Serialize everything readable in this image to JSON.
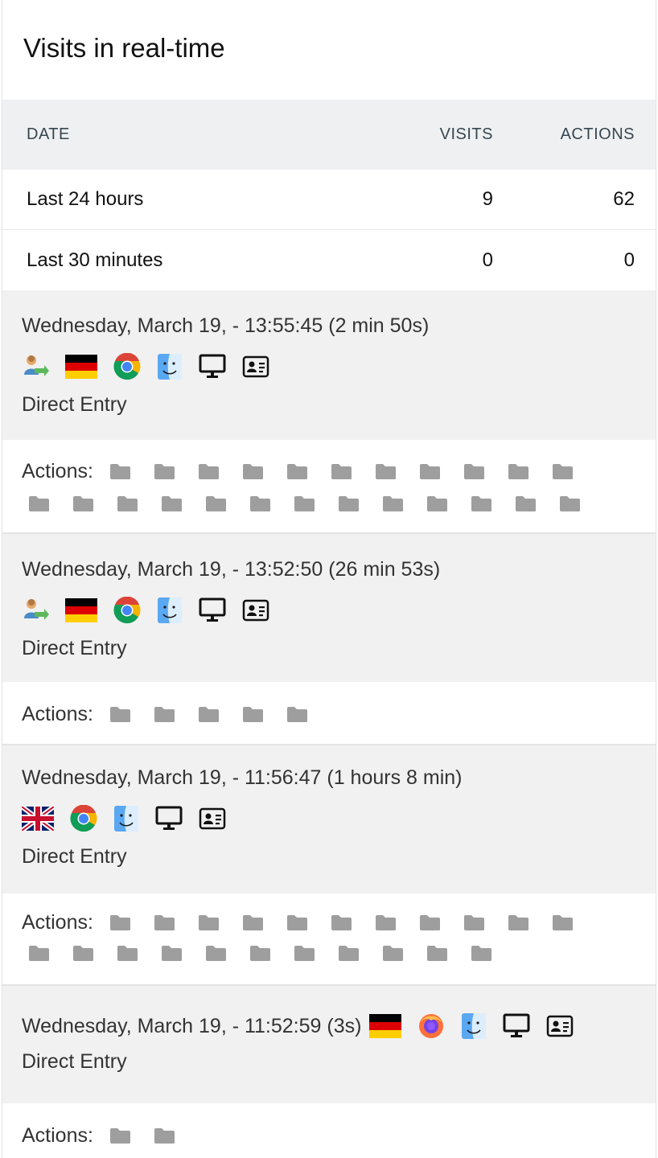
{
  "widget": {
    "title": "Visits in real-time"
  },
  "summary": {
    "headers": {
      "date": "DATE",
      "visits": "VISITS",
      "actions": "ACTIONS"
    },
    "rows": [
      {
        "label": "Last 24 hours",
        "visits": "9",
        "actions": "62"
      },
      {
        "label": "Last 30 minutes",
        "visits": "0",
        "actions": "0"
      }
    ]
  },
  "visits": [
    {
      "time": "Wednesday, March 19, - 13:55:45 (2 min 50s)",
      "icons": [
        "returning-visitor-icon",
        "germany-flag-icon",
        "chrome-icon",
        "macos-finder-icon",
        "desktop-icon",
        "visitor-profile-icon"
      ],
      "referrer": "Direct Entry",
      "actions_label": "Actions:",
      "action_count": 24
    },
    {
      "time": "Wednesday, March 19, - 13:52:50 (26 min 53s)",
      "icons": [
        "returning-visitor-icon",
        "germany-flag-icon",
        "chrome-icon",
        "macos-finder-icon",
        "desktop-icon",
        "visitor-profile-icon"
      ],
      "referrer": "Direct Entry",
      "actions_label": "Actions:",
      "action_count": 5
    },
    {
      "time": "Wednesday, March 19, - 11:56:47 (1 hours 8 min)",
      "icons": [
        "uk-flag-icon",
        "chrome-icon",
        "macos-finder-icon",
        "desktop-icon",
        "visitor-profile-icon"
      ],
      "referrer": "Direct Entry",
      "actions_label": "Actions:",
      "action_count": 22
    },
    {
      "time": "Wednesday, March 19, - 11:52:59 (3s)",
      "icons": [
        "germany-flag-icon",
        "firefox-icon",
        "macos-finder-icon",
        "desktop-icon",
        "visitor-profile-icon"
      ],
      "referrer": "Direct Entry",
      "actions_label": "Actions:",
      "action_count": 2
    }
  ],
  "colors": {
    "header_bg": "#eef0f2",
    "visit_bg": "#f1f1f1",
    "folder": "#9e9e9e"
  }
}
